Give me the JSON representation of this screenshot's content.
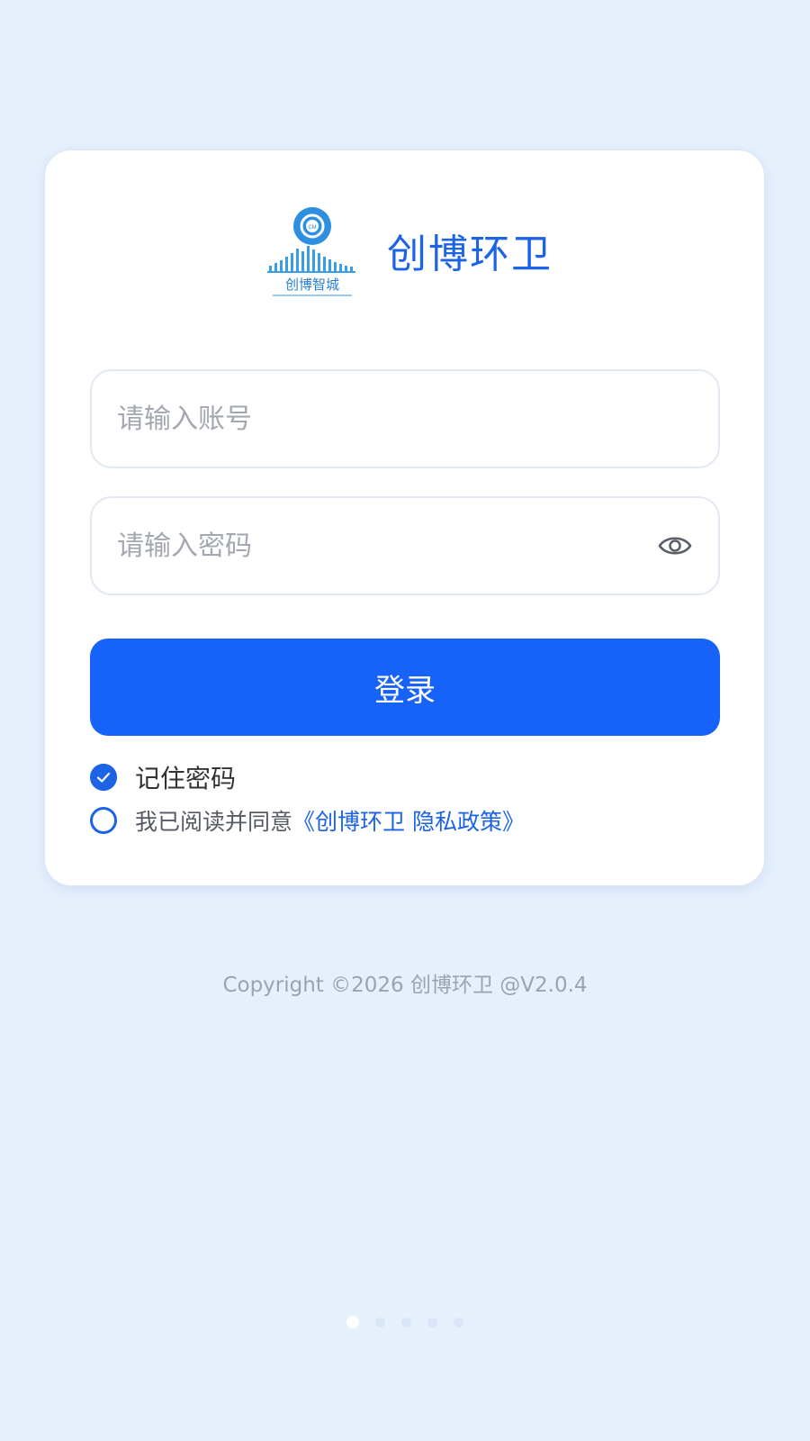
{
  "app": {
    "title": "创博环卫",
    "logo": {
      "icon": "city-skyline-logo-icon",
      "text": "创博智城",
      "badge": "CM"
    }
  },
  "login_form": {
    "account_placeholder": "请输入账号",
    "account_value": "",
    "password_placeholder": "请输入密码",
    "password_value": "",
    "password_toggle_icon": "eye-icon",
    "submit_label": "登录",
    "remember_password_label": "记住密码",
    "remember_password_checked": true,
    "agree_text": "我已阅读并同意",
    "policy_link": "《创博环卫 隐私政策》",
    "agree_checked": false
  },
  "footer": {
    "copyright": "Copyright ©2026 创博环卫 @V2.0.4"
  },
  "pager": {
    "count": 5,
    "active_index": 0
  },
  "colors": {
    "page_background": "#e6f0fd",
    "primary": "#1762f8",
    "accent_text": "#1d63e6",
    "card_background": "#ffffff"
  }
}
